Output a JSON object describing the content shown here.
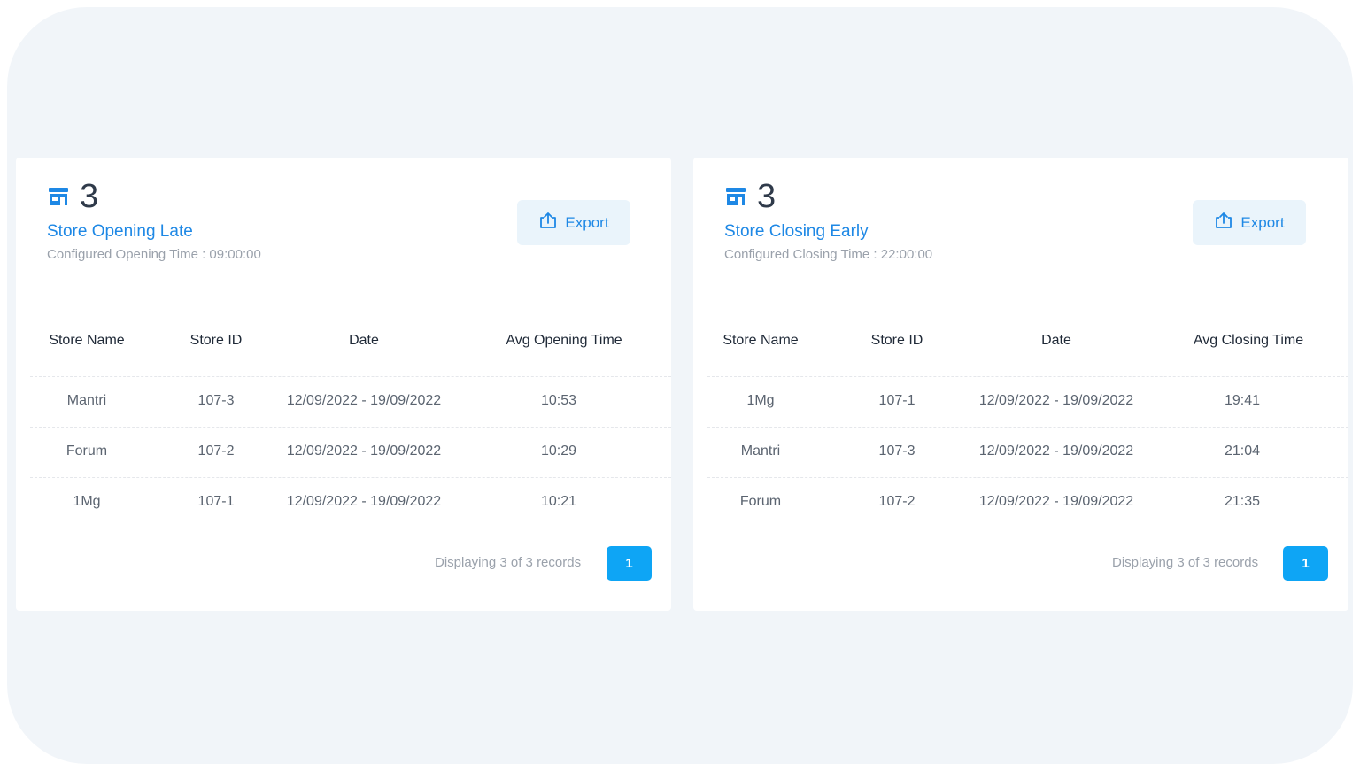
{
  "accent_color": "#1e88e5",
  "pagination_color": "#0ea5f5",
  "panels": [
    {
      "icon": "store-icon",
      "count": "3",
      "title": "Store Opening Late",
      "subtitle": "Configured Opening Time : 09:00:00",
      "export_label": "Export",
      "export_icon": "share-export-icon",
      "columns": [
        "Store Name",
        "Store ID",
        "Date",
        "Avg Opening Time"
      ],
      "rows": [
        [
          "Mantri",
          "107-3",
          "12/09/2022 - 19/09/2022",
          "10:53"
        ],
        [
          "Forum",
          "107-2",
          "12/09/2022 - 19/09/2022",
          "10:29"
        ],
        [
          "1Mg",
          "107-1",
          "12/09/2022 - 19/09/2022",
          "10:21"
        ]
      ],
      "footer_text": "Displaying 3 of 3 records",
      "current_page": "1"
    },
    {
      "icon": "store-icon",
      "count": "3",
      "title": "Store Closing Early",
      "subtitle": "Configured Closing Time : 22:00:00",
      "export_label": "Export",
      "export_icon": "share-export-icon",
      "columns": [
        "Store Name",
        "Store ID",
        "Date",
        "Avg Closing Time"
      ],
      "rows": [
        [
          "1Mg",
          "107-1",
          "12/09/2022 - 19/09/2022",
          "19:41"
        ],
        [
          "Mantri",
          "107-3",
          "12/09/2022 - 19/09/2022",
          "21:04"
        ],
        [
          "Forum",
          "107-2",
          "12/09/2022 - 19/09/2022",
          "21:35"
        ]
      ],
      "footer_text": "Displaying 3 of 3 records",
      "current_page": "1"
    }
  ]
}
